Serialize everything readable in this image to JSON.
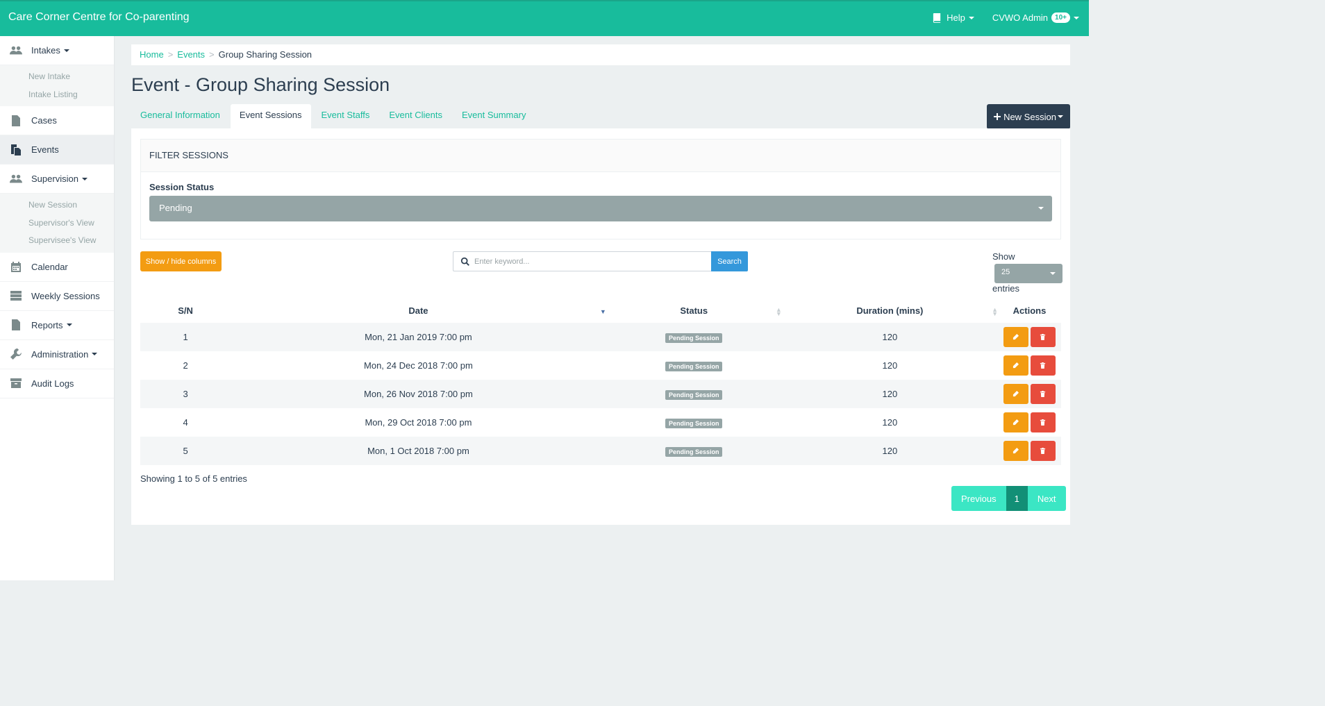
{
  "app": {
    "title": "Care Corner Centre for Co-parenting"
  },
  "header": {
    "help": "Help",
    "user": "CVWO Admin",
    "badge": "10+"
  },
  "sidebar": {
    "intakes": "Intakes",
    "intakes_sub": [
      "New Intake",
      "Intake Listing"
    ],
    "cases": "Cases",
    "events": "Events",
    "supervision": "Supervision",
    "supervision_sub": [
      "New Session",
      "Supervisor's View",
      "Supervisee's View"
    ],
    "calendar": "Calendar",
    "weekly": "Weekly Sessions",
    "reports": "Reports",
    "administration": "Administration",
    "audit": "Audit Logs"
  },
  "breadcrumb": {
    "home": "Home",
    "events": "Events",
    "current": "Group Sharing Session"
  },
  "page": {
    "title": "Event - Group Sharing Session"
  },
  "tabs": [
    "General Information",
    "Event Sessions",
    "Event Staffs",
    "Event Clients",
    "Event Summary"
  ],
  "new_session": "New Session",
  "filter": {
    "heading": "FILTER SESSIONS",
    "label": "Session Status",
    "value": "Pending"
  },
  "toolbar": {
    "show_hide": "Show / hide columns",
    "search_placeholder": "Enter keyword...",
    "search_button": "Search",
    "show": "Show",
    "entries_value": "25",
    "entries": "entries"
  },
  "table": {
    "headers": [
      "S/N",
      "Date",
      "Status",
      "Duration (mins)",
      "Actions"
    ],
    "rows": [
      {
        "sn": "1",
        "date": "Mon, 21 Jan 2019 7:00 pm",
        "status": "Pending Session",
        "duration": "120"
      },
      {
        "sn": "2",
        "date": "Mon, 24 Dec 2018 7:00 pm",
        "status": "Pending Session",
        "duration": "120"
      },
      {
        "sn": "3",
        "date": "Mon, 26 Nov 2018 7:00 pm",
        "status": "Pending Session",
        "duration": "120"
      },
      {
        "sn": "4",
        "date": "Mon, 29 Oct 2018 7:00 pm",
        "status": "Pending Session",
        "duration": "120"
      },
      {
        "sn": "5",
        "date": "Mon, 1 Oct 2018 7:00 pm",
        "status": "Pending Session",
        "duration": "120"
      }
    ]
  },
  "footer": {
    "showing": "Showing 1 to 5 of 5 entries",
    "previous": "Previous",
    "page": "1",
    "next": "Next"
  }
}
